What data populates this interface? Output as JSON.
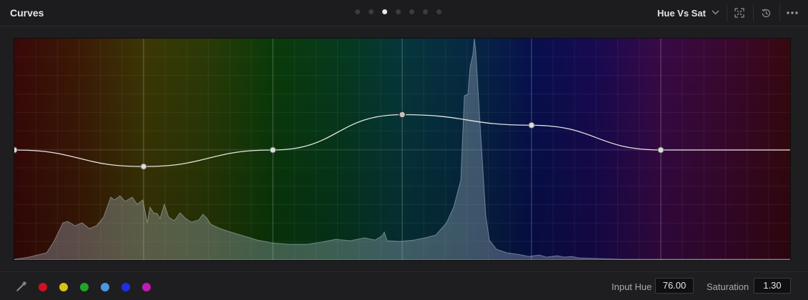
{
  "header": {
    "title": "Curves",
    "page_dots": 7,
    "active_page_index": 2,
    "mode_label": "Hue Vs Sat",
    "icons": [
      "expand-icon",
      "reset-icon",
      "more-options-icon"
    ]
  },
  "graph": {
    "curve_points": [
      {
        "hue_fraction": 0.0,
        "saturation": 1.0
      },
      {
        "hue_fraction": 0.1667,
        "saturation": 0.86
      },
      {
        "hue_fraction": 0.3333,
        "saturation": 1.0
      },
      {
        "hue_fraction": 0.5,
        "saturation": 1.3
      },
      {
        "hue_fraction": 0.6667,
        "saturation": 1.21
      },
      {
        "hue_fraction": 0.8333,
        "saturation": 1.0
      }
    ],
    "selected_point_index": 3
  },
  "footer": {
    "swatch_colors": [
      "#d0121e",
      "#d8c214",
      "#1fa62a",
      "#4d97e0",
      "#1f2fe6",
      "#c01cb4"
    ],
    "swatch_names": [
      "red",
      "yellow",
      "green",
      "cyan",
      "blue",
      "magenta"
    ],
    "input_hue_label": "Input Hue",
    "input_hue_value": "76.00",
    "saturation_label": "Saturation",
    "saturation_value": "1.30"
  }
}
